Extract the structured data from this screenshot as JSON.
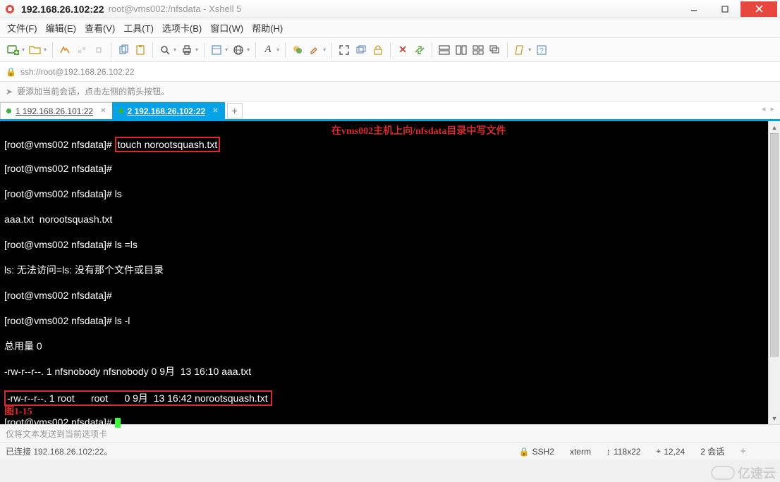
{
  "title": {
    "host": "192.168.26.102:22",
    "sub": "root@vms002:/nfsdata - Xshell 5"
  },
  "menu": {
    "file": "文件(F)",
    "edit": "编辑(E)",
    "view": "查看(V)",
    "tools": "工具(T)",
    "tabs": "选项卡(B)",
    "window": "窗口(W)",
    "help": "帮助(H)"
  },
  "address": "ssh://root@192.168.26.102:22",
  "tip": "要添加当前会话，点击左侧的箭头按钮。",
  "tabs": {
    "t1": "1 192.168.26.101:22",
    "t2": "2 192.168.26.102:22"
  },
  "term": {
    "p1": "[root@vms002 nfsdata]# ",
    "cmd1": "touch norootsquash.txt",
    "annot1": "在vms002主机上向/nfsdata目录中写文件",
    "p2": "[root@vms002 nfsdata]#",
    "p3": "[root@vms002 nfsdata]# ls",
    "out1": "aaa.txt  norootsquash.txt",
    "p4": "[root@vms002 nfsdata]# ls =ls",
    "out2": "ls: 无法访问=ls: 没有那个文件或目录",
    "p5": "[root@vms002 nfsdata]#",
    "p6": "[root@vms002 nfsdata]# ls -l",
    "out3": "总用量 0",
    "out4": "-rw-r--r--. 1 nfsnobody nfsnobody 0 9月  13 16:10 aaa.txt",
    "out5": "-rw-r--r--. 1 root      root      0 9月  13 16:42 norootsquash.txt",
    "p7": "[root@vms002 nfsdata]# ",
    "figlabel": "图1-15"
  },
  "send_hint": "仅将文本发送到当前选项卡",
  "status": {
    "conn": "已连接 192.168.26.102:22。",
    "proto": "SSH2",
    "term": "xterm",
    "size": "118x22",
    "pos": "12,24",
    "sess": "2 会话"
  },
  "watermark": "亿速云"
}
